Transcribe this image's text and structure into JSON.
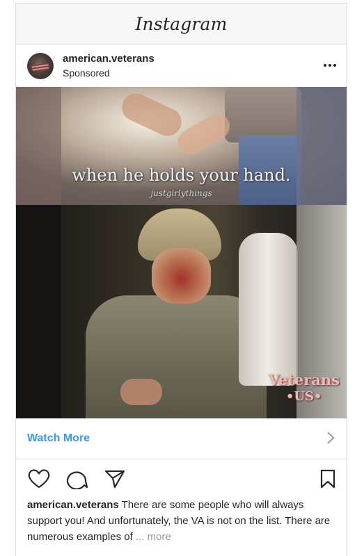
{
  "app": {
    "title": "Instagram"
  },
  "post": {
    "username": "american.veterans",
    "sponsored_label": "Sponsored",
    "media": {
      "caption_main": "when he holds your hand.",
      "caption_sub": "justgirlythings",
      "watermark_line1": "Veterans",
      "watermark_line2": "•US•"
    },
    "cta": {
      "label": "Watch More"
    },
    "caption": {
      "username": "american.veterans",
      "text": " There are some people who will always support you! And unfortunately, the VA is not on the list. There are numerous examples of ",
      "ellipsis": "...",
      "more_label": " more"
    }
  },
  "icons": [
    "more-options-icon",
    "heart-icon",
    "comment-icon",
    "share-icon",
    "bookmark-icon",
    "chevron-right-icon"
  ],
  "colors": {
    "link": "#3897f0",
    "text": "#262626",
    "muted": "#999999",
    "border": "#dbdbdb"
  }
}
